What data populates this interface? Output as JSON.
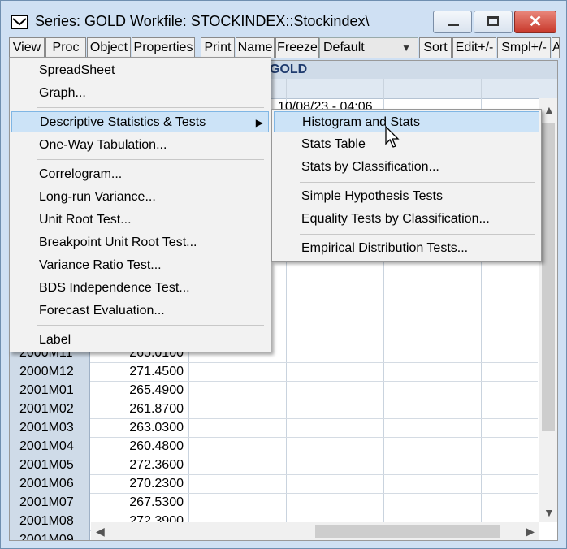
{
  "window": {
    "title": "Series: GOLD    Workfile: STOCKINDEX::Stockindex\\",
    "close_glyph": "✕"
  },
  "toolbar": {
    "view": "View",
    "proc": "Proc",
    "object": "Object",
    "properties": "Properties",
    "print": "Print",
    "name": "Name",
    "freeze": "Freeze",
    "display_mode": "Default",
    "sort": "Sort",
    "edit": "Edit+/-",
    "smpl": "Smpl+/-",
    "more": "A"
  },
  "grid": {
    "column_header": "GOLD",
    "date_cell": "10/08/23 - 04:06",
    "rows": [
      {
        "label": "2000M11",
        "value": "265.0100"
      },
      {
        "label": "2000M12",
        "value": "271.4500"
      },
      {
        "label": "2001M01",
        "value": "265.4900"
      },
      {
        "label": "2001M02",
        "value": "261.8700"
      },
      {
        "label": "2001M03",
        "value": "263.0300"
      },
      {
        "label": "2001M04",
        "value": "260.4800"
      },
      {
        "label": "2001M05",
        "value": "272.3600"
      },
      {
        "label": "2001M06",
        "value": "270.2300"
      },
      {
        "label": "2001M07",
        "value": "267.5300"
      },
      {
        "label": "2001M08",
        "value": "272.3900"
      },
      {
        "label": "2001M09",
        "value": ""
      }
    ]
  },
  "view_menu": {
    "items": [
      "SpreadSheet",
      "Graph...",
      "Descriptive Statistics & Tests",
      "One-Way Tabulation...",
      "Correlogram...",
      "Long-run Variance...",
      "Unit Root Test...",
      "Breakpoint Unit Root Test...",
      "Variance Ratio Test...",
      "BDS Independence Test...",
      "Forecast Evaluation...",
      "Label"
    ]
  },
  "submenu": {
    "items": [
      "Histogram and Stats",
      "Stats Table",
      "Stats by Classification...",
      "Simple Hypothesis Tests",
      "Equality Tests by Classification...",
      "Empirical Distribution Tests..."
    ]
  }
}
